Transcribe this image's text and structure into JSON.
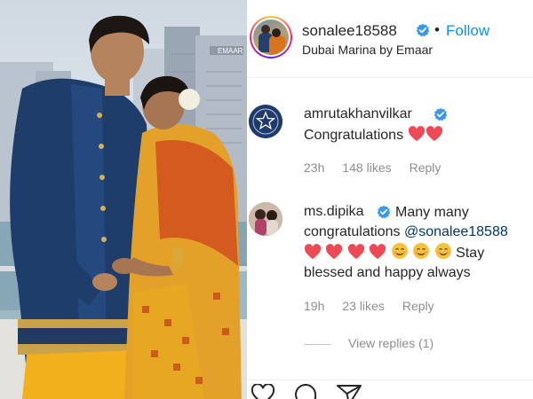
{
  "post": {
    "username": "sonalee18588",
    "separator": "•",
    "follow_label": "Follow",
    "location": "Dubai Marina by Emaar",
    "photo_sign": "EMAAR"
  },
  "comments": [
    {
      "username": "amrutakhanvilkar",
      "text": "Congratulations",
      "emoji_icons": [
        "red-heart-icon",
        "red-heart-icon"
      ],
      "time": "23h",
      "likes": "148 likes",
      "reply_label": "Reply"
    },
    {
      "username": "ms.dipika",
      "text_before": "Many many congratulations",
      "mention": "@sonalee18588",
      "emoji_icons": [
        "red-heart-icon",
        "red-heart-icon",
        "red-heart-icon",
        "red-heart-icon",
        "smiling-face-icon",
        "smiling-face-icon",
        "smiling-face-icon"
      ],
      "text_after": "Stay blessed and happy always",
      "time": "19h",
      "likes": "23 likes",
      "reply_label": "Reply"
    }
  ],
  "view_replies": "View replies (1)",
  "action_icons": [
    "heart-outline-icon",
    "comment-icon",
    "share-icon"
  ],
  "colors": {
    "accent_blue": "#0095f6",
    "verified_blue": "#3897f0",
    "heart_red": "#ed4956",
    "muted_text": "#8e8e8e",
    "mention_blue": "#00376b"
  }
}
